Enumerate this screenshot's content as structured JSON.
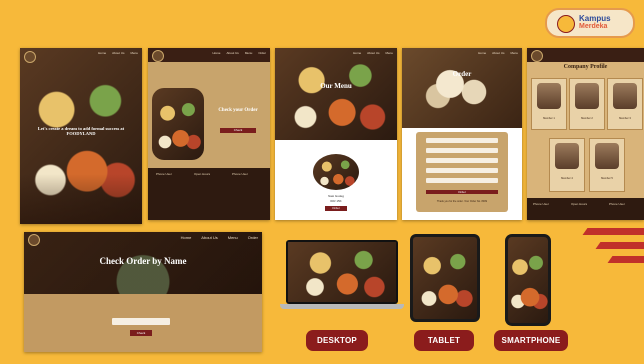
{
  "brand": {
    "title": "Kampus",
    "subtitle": "Merdeka"
  },
  "nav": [
    "Home",
    "About Us",
    "Menu",
    "Order"
  ],
  "home": {
    "headline": "Let's create a dream to add formal success at FOODYLAND"
  },
  "check_your_order": {
    "title": "Check your Order",
    "button": "Check"
  },
  "menu_page": {
    "title": "Our Menu",
    "item": "Nasi Gudeg",
    "price": "IDR 15K",
    "button": "Order"
  },
  "order_page": {
    "title": "Order",
    "button": "Order",
    "note": "Thank you for the order. Your Order No. 8009"
  },
  "company": {
    "title": "Company Profile",
    "members": [
      "Member 1",
      "Member 2",
      "Member 3",
      "Member 4",
      "Member 5"
    ]
  },
  "footer": {
    "col1": "Phone User",
    "col2": "Open Hours",
    "col3": "Phone User"
  },
  "check_by_name": {
    "title": "Check Order by Name",
    "button": "Check"
  },
  "devices": {
    "desktop": "DESKTOP",
    "tablet": "TABLET",
    "smartphone": "SMARTPHONE"
  },
  "colors": {
    "background": "#f7b93a",
    "accent": "#8b1c1c",
    "dark": "#3a1f14",
    "tan": "#c8a46c"
  }
}
